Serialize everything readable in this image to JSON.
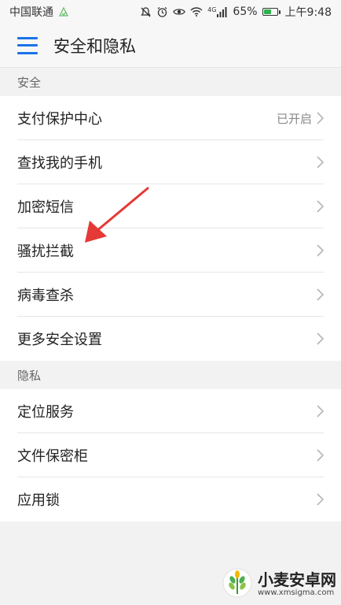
{
  "status_bar": {
    "carrier": "中国联通",
    "battery_percent": "65%",
    "time": "上午9:48",
    "network": "4G",
    "icons": [
      "signal-check-icon",
      "mute-icon",
      "alarm-icon",
      "eye-icon",
      "wifi-icon",
      "cell-signal-icon",
      "battery-icon"
    ],
    "battery_level": 0.65
  },
  "header": {
    "title": "安全和隐私",
    "menu_icon": "menu-icon"
  },
  "sections": [
    {
      "title": "安全",
      "items": [
        {
          "label": "支付保护中心",
          "status": "已开启"
        },
        {
          "label": "查找我的手机",
          "status": ""
        },
        {
          "label": "加密短信",
          "status": ""
        },
        {
          "label": "骚扰拦截",
          "status": ""
        },
        {
          "label": "病毒查杀",
          "status": ""
        },
        {
          "label": "更多安全设置",
          "status": ""
        }
      ]
    },
    {
      "title": "隐私",
      "items": [
        {
          "label": "定位服务",
          "status": ""
        },
        {
          "label": "文件保密柜",
          "status": ""
        },
        {
          "label": "应用锁",
          "status": ""
        }
      ]
    }
  ],
  "annotation": {
    "arrow_color": "#e53935",
    "arrow_icon": "red-arrow-icon"
  },
  "watermark": {
    "main": "小麦安卓网",
    "sub": "www.xmsigma.com",
    "logo_icon": "wheat-logo-icon"
  },
  "colors": {
    "accent": "#1a73e8",
    "battery_fill": "#2bb34b"
  }
}
